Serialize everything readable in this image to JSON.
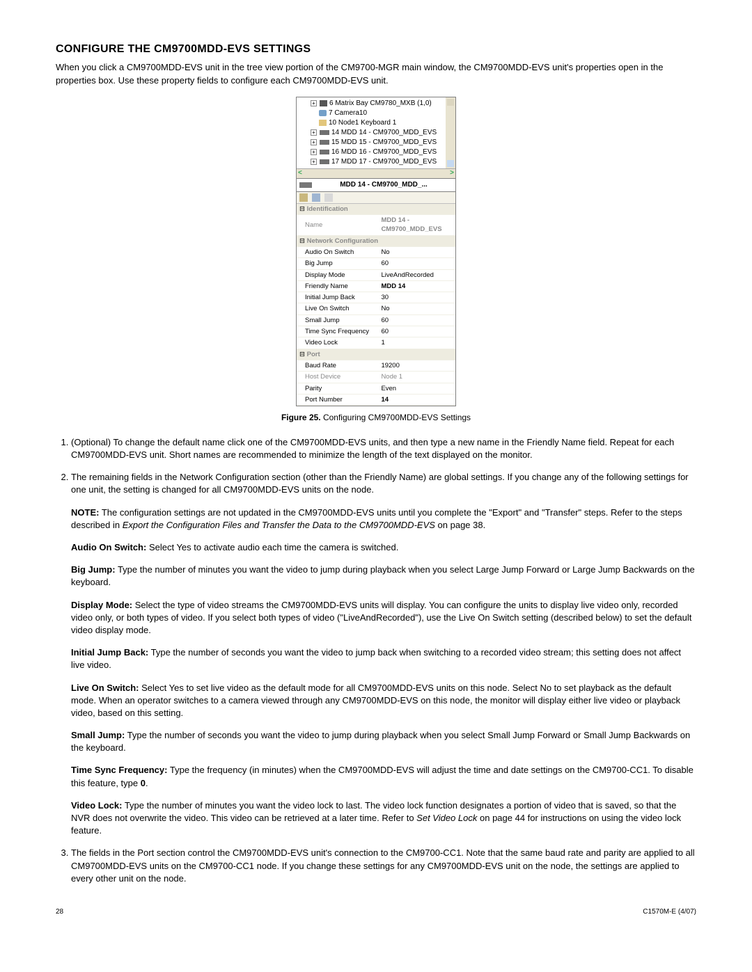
{
  "heading": "CONFIGURE THE CM9700MDD-EVS SETTINGS",
  "intro": "When you click a CM9700MDD-EVS unit in the tree view portion of the CM9700-MGR main window, the CM9700MDD-EVS unit's properties open in the properties box. Use these property fields to configure each CM9700MDD-EVS unit.",
  "tree": [
    {
      "expand": true,
      "icon": "node-icon",
      "label": "6 Matrix Bay CM9780_MXB (1,0)"
    },
    {
      "expand": false,
      "icon": "node-icon cam",
      "label": "7 Camera10",
      "indent": 1
    },
    {
      "expand": false,
      "icon": "node-icon kb",
      "label": "10 Node1 Keyboard 1",
      "indent": 1
    },
    {
      "expand": true,
      "icon": "node-icon mdd",
      "label": "14 MDD 14 - CM9700_MDD_EVS"
    },
    {
      "expand": true,
      "icon": "node-icon mdd",
      "label": "15 MDD 15 - CM9700_MDD_EVS"
    },
    {
      "expand": true,
      "icon": "node-icon mdd",
      "label": "16 MDD 16 - CM9700_MDD_EVS"
    },
    {
      "expand": true,
      "icon": "node-icon mdd",
      "label": "17 MDD 17 - CM9700_MDD_EVS"
    }
  ],
  "panel_title": "MDD 14 - CM9700_MDD_...",
  "props": {
    "sections": [
      {
        "title": "Identification",
        "rows": [
          {
            "k": "Name",
            "v": "MDD 14 - CM9700_MDD_EVS",
            "readonly": true,
            "bold": true,
            "grayval": true
          }
        ]
      },
      {
        "title": "Network Configuration",
        "rows": [
          {
            "k": "Audio On Switch",
            "v": "No"
          },
          {
            "k": "Big Jump",
            "v": "60"
          },
          {
            "k": "Display Mode",
            "v": "LiveAndRecorded"
          },
          {
            "k": "Friendly Name",
            "v": "MDD 14",
            "bold": true
          },
          {
            "k": "Initial Jump Back",
            "v": "30"
          },
          {
            "k": "Live On Switch",
            "v": "No"
          },
          {
            "k": "Small Jump",
            "v": "60"
          },
          {
            "k": "Time Sync Frequency",
            "v": "60"
          },
          {
            "k": "Video Lock",
            "v": "1"
          }
        ]
      },
      {
        "title": "Port",
        "rows": [
          {
            "k": "Baud Rate",
            "v": "19200"
          },
          {
            "k": "Host Device",
            "v": "Node 1",
            "readonly": true,
            "grayval": true
          },
          {
            "k": "Parity",
            "v": "Even"
          },
          {
            "k": "Port Number",
            "v": "14",
            "bold": true
          }
        ]
      }
    ]
  },
  "figure_caption_bold": "Figure 25.",
  "figure_caption_rest": " Configuring CM9700MDD-EVS Settings",
  "steps": {
    "s1": "(Optional) To change the default name click one of the CM9700MDD-EVS units, and then type a new name in the Friendly Name field. Repeat for each CM9700MDD-EVS unit. Short names are recommended to minimize the length of the text displayed on the monitor.",
    "s2_intro": "The remaining fields in the Network Configuration section (other than the Friendly Name) are global settings. If you change any of the following settings for one unit, the setting is changed for all CM9700MDD-EVS units on the node.",
    "note_label": "NOTE:",
    "note_body_1": " The configuration settings are not updated in the CM9700MDD-EVS units until you complete the \"Export\" and \"Transfer\" steps. Refer to the steps described in ",
    "note_italic": "Export the Configuration Files and Transfer the Data to the CM9700MDD-EVS",
    "note_body_2": " on page 38.",
    "audio_label": "Audio On Switch:",
    "audio": "  Select Yes to activate audio each time the camera is switched.",
    "bigjump_label": "Big Jump:",
    "bigjump": "  Type the number of minutes you want the video to jump during playback when you select Large Jump Forward or Large Jump Backwards on the keyboard.",
    "display_label": "Display Mode:",
    "display": "  Select the type of video streams the CM9700MDD-EVS units will display. You can configure the units to display live video only, recorded video only, or both types of video. If you select both types of video (\"LiveAndRecorded\"), use the Live On Switch setting (described below) to set the default video display mode.",
    "initial_label": "Initial Jump Back:",
    "initial": "  Type the number of seconds you want the video to jump back when switching to a recorded video stream; this setting does not affect live video.",
    "live_label": "Live On Switch:",
    "live": "  Select Yes to set live video as the default mode for all CM9700MDD-EVS units on this node. Select No to set playback as the default mode. When an operator switches to a camera viewed through any CM9700MDD-EVS on this node, the monitor will display either live video or playback video, based on this setting.",
    "small_label": "Small Jump:",
    "small": "  Type the number of seconds you want the video to jump during playback when you select Small Jump Forward or Small Jump Backwards on the keyboard.",
    "time_label": "Time Sync Frequency:",
    "time_1": "  Type the frequency (in minutes) when the CM9700MDD-EVS will adjust the time and date settings on the CM9700-CC1. To disable this feature, type ",
    "time_bold": "0",
    "time_2": ".",
    "vlock_label": "Video Lock:",
    "vlock_1": "  Type the number of minutes you want the video lock to last. The video lock function designates a portion of video that is saved, so that the NVR does not overwrite the video. This video can be retrieved at a later time. Refer to ",
    "vlock_italic": "Set Video Lock",
    "vlock_2": " on page 44 for instructions on using the video lock feature.",
    "s3": "The fields in the Port section control the CM9700MDD-EVS unit's connection to the CM9700-CC1. Note that the same baud rate and parity are applied to all CM9700MDD-EVS units on the CM9700-CC1 node. If you change these settings for any CM9700MDD-EVS unit on the node, the settings are applied to every other unit on the node."
  },
  "footer_left": "28",
  "footer_right": "C1570M-E (4/07)"
}
